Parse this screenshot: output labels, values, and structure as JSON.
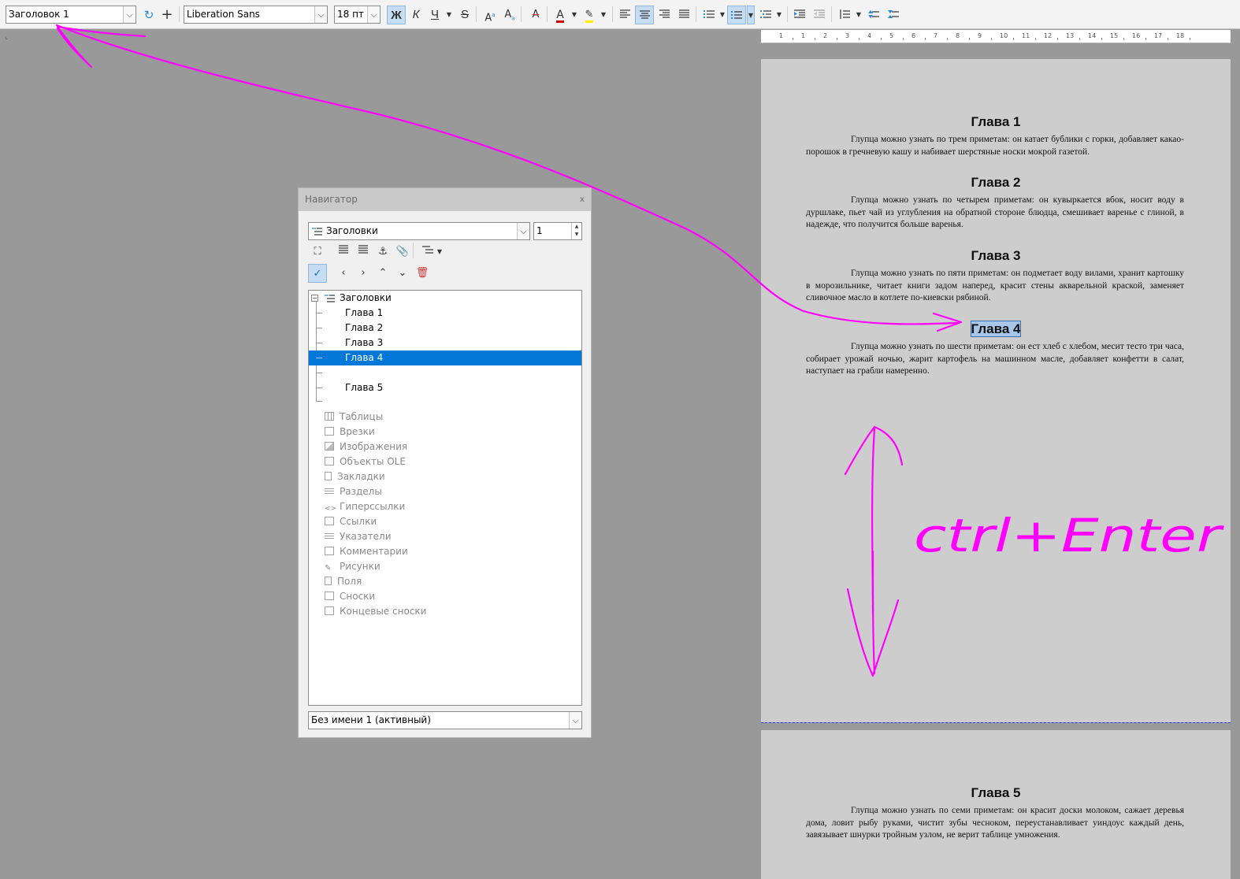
{
  "toolbar": {
    "paragraph_style": "Заголовок 1",
    "font_name": "Liberation Sans",
    "font_size": "18 пт",
    "bold": "Ж",
    "italic": "К",
    "underline": "Ч",
    "strike": "S",
    "superscript": "A",
    "subscript": "A",
    "clear_format": "A",
    "font_color_letter": "A",
    "accent_active": "#c5dcf3"
  },
  "ruler": {
    "ticks": [
      "1",
      "1",
      "2",
      "3",
      "4",
      "5",
      "6",
      "7",
      "8",
      "9",
      "10",
      "11",
      "12",
      "13",
      "14",
      "15",
      "16",
      "17",
      "18"
    ]
  },
  "document": {
    "chapters": [
      {
        "title": "Глава 1",
        "text": "Глупца можно узнать по трем приметам: он катает бублики с горки, добавляет какао-порошок в гречневую кашу и набивает шерстяные носки мокрой газетой."
      },
      {
        "title": "Глава 2",
        "text": "Глупца можно узнать по четырем приметам: он кувыркается вбок, носит воду в дуршлаке, пьет чай из углубления на обратной стороне блюдца, смешивает варенье с глиной, в надежде, что получится больше варенья."
      },
      {
        "title": "Глава 3",
        "text": "Глупца можно узнать по пяти приметам: он подметает воду вилами, хранит картошку в морозильнике, читает книги задом наперед, красит стены акварельной краской, заменяет сливочное масло в котлете по-киевски рябиной."
      },
      {
        "title": "Глава 4",
        "text": "Глупца можно узнать по шести приметам: он ест хлеб с хлебом, месит тесто три часа, собирает урожай ночью, жарит картофель на машинном масле, добавляет конфетти в салат, наступает на грабли намеренно."
      },
      {
        "title": "Глава 5",
        "text": "Глупца можно узнать по семи приметам: он красит доски молоком, сажает деревья дома, ловит рыбу руками, чистит зубы чесноком, переустанавливает уиндоус каждый день, завязывает шнурки тройным узлом, не верит таблице умножения."
      }
    ]
  },
  "navigator": {
    "title": "Навигатор",
    "close": "x",
    "category_select": "Заголовки",
    "level_value": "1",
    "tree_root": "Заголовки",
    "headings": [
      "Глава 1",
      "Глава 2",
      "Глава 3",
      "Глава 4",
      "Глава 5"
    ],
    "selected_heading": "Глава 4",
    "categories": [
      "Таблицы",
      "Врезки",
      "Изображения",
      "Объекты OLE",
      "Закладки",
      "Разделы",
      "Гиперссылки",
      "Ссылки",
      "Указатели",
      "Комментарии",
      "Рисунки",
      "Поля",
      "Сноски",
      "Концевые сноски"
    ],
    "document_select": "Без имени 1 (активный)"
  },
  "annotation": {
    "text": "ctrl+Enter",
    "color": "#ff00ff"
  }
}
